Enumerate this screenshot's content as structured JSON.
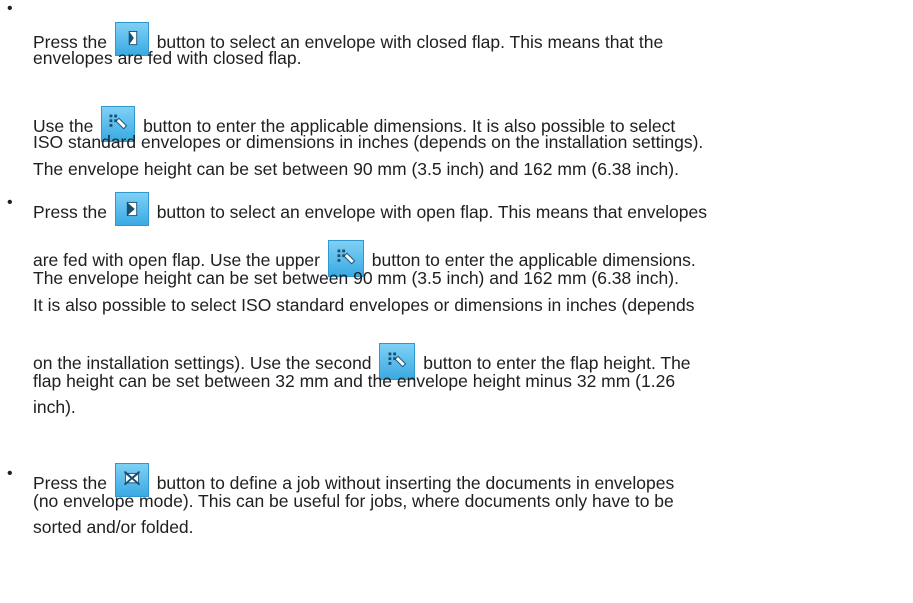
{
  "bullet_1": {
    "l1a": "Press the",
    "l1b": "button to select an envelope with closed flap. This means that the",
    "l2": "envelopes are fed with closed flap.",
    "l3a": "Use the",
    "l3b": "button to enter the applicable dimensions. It is also possible to select",
    "l4": "ISO standard envelopes or dimensions in inches (depends on the installation settings).",
    "l5": "The envelope height can be set between 90 mm (3.5 inch) and 162 mm (6.38 inch)."
  },
  "bullet_2": {
    "l1a": "Press the",
    "l1b": "button to select an envelope with open flap. This means that envelopes",
    "l2a": "are fed with open flap. Use the upper",
    "l2b": "button to enter the applicable dimensions.",
    "l3": "The envelope height can be set between 90 mm (3.5 inch) and 162 mm (6.38 inch).",
    "l4": "It is also possible to select ISO standard envelopes or dimensions in inches (depends",
    "l5a": "on the installation settings). Use the second",
    "l5b": "button to enter the flap height. The",
    "l6": "flap height can be set between 32 mm and the envelope height minus 32 mm (1.26",
    "l7": "inch)."
  },
  "bullet_3": {
    "l1a": "Press the",
    "l1b": "button to define a job without inserting the documents in envelopes",
    "l2": "(no envelope mode). This can be useful for jobs, where documents only have to be",
    "l3": "sorted and/or folded."
  },
  "icons": {
    "closed_flap": "closed-flap-envelope-icon",
    "dimensions": "dimensions-edit-icon",
    "open_flap": "open-flap-envelope-icon",
    "no_envelope": "no-envelope-icon"
  },
  "colors": {
    "button_top": "#7fd0f5",
    "button_bottom": "#3aaae3",
    "text": "#202020"
  }
}
